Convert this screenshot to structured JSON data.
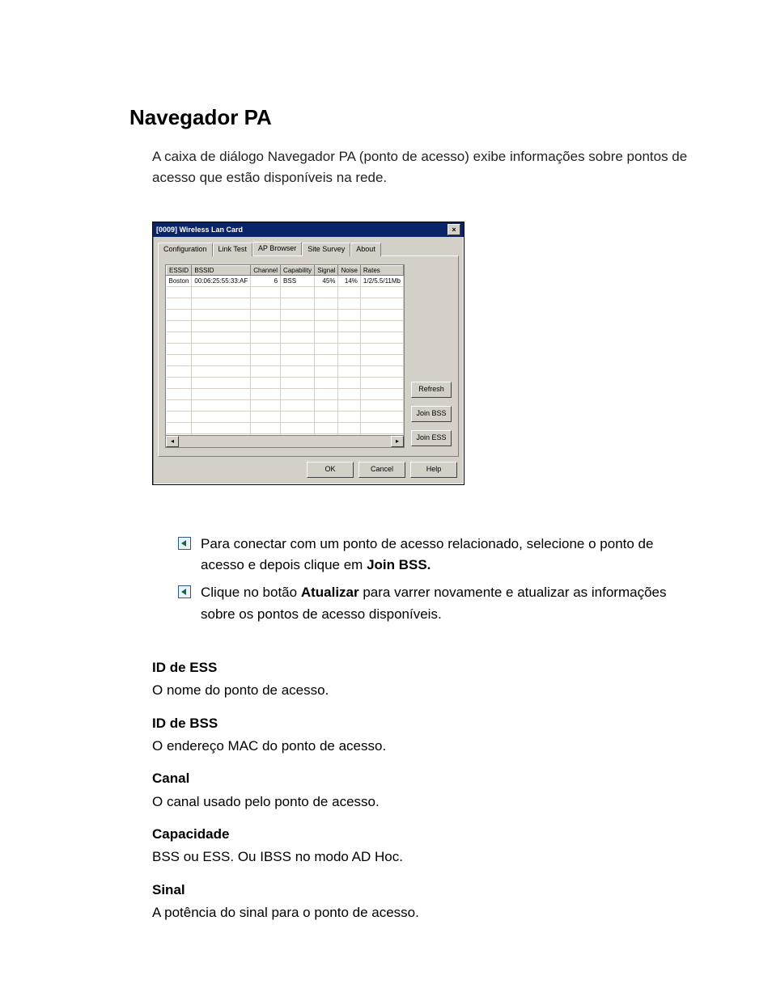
{
  "heading": "Navegador PA",
  "intro": "A caixa de diálogo Navegador PA (ponto de acesso) exibe informações sobre pontos de acesso que estão disponíveis na rede.",
  "dialog": {
    "title": "[0009] Wireless Lan Card",
    "tabs": [
      "Configuration",
      "Link Test",
      "AP Browser",
      "Site Survey",
      "About"
    ],
    "active_tab": "AP Browser",
    "columns": [
      "ESSID",
      "BSSID",
      "Channel",
      "Capability",
      "Signal",
      "Noise",
      "Rates"
    ],
    "rows": [
      {
        "essid": "Boston",
        "bssid": "00:06:25:55:33:AF",
        "channel": "6",
        "capability": "BSS",
        "signal": "45%",
        "noise": "14%",
        "rates": "1/2/5.5/11Mb"
      }
    ],
    "side_buttons": {
      "refresh": "Refresh",
      "join_bss": "Join BSS",
      "join_ess": "Join ESS"
    },
    "bottom_buttons": {
      "ok": "OK",
      "cancel": "Cancel",
      "help": "Help"
    }
  },
  "bullets": [
    {
      "pre": "Para conectar com um ponto de acesso relacionado, selecione o ponto de acesso e depois clique em ",
      "strong": "Join BSS.",
      "post": ""
    },
    {
      "pre": "Clique no botão ",
      "strong": "Atualizar",
      "post": " para varrer novamente e atualizar as informações sobre os pontos de acesso disponíveis."
    }
  ],
  "definitions": [
    {
      "term": "ID de ESS",
      "desc": "O nome do ponto de acesso."
    },
    {
      "term": "ID de BSS",
      "desc": "O endereço MAC do ponto de acesso."
    },
    {
      "term": "Canal",
      "desc": "O canal usado pelo ponto de acesso."
    },
    {
      "term": "Capacidade",
      "desc": "BSS ou ESS. Ou IBSS no modo AD Hoc."
    },
    {
      "term": "Sinal",
      "desc": "A potência do sinal para o ponto de acesso."
    }
  ]
}
